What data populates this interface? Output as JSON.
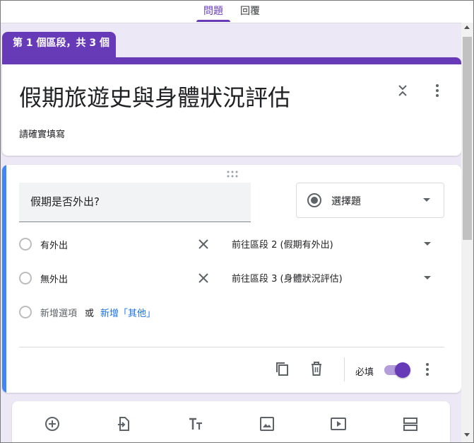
{
  "tabs": {
    "questions": "問題",
    "responses": "回覆"
  },
  "section": {
    "indicator": "第 1 個區段，共 3 個",
    "title": "假期旅遊史與身體狀況評估",
    "description": "請確實填寫"
  },
  "question": {
    "text": "假期是否外出?",
    "type": "選擇題",
    "options": [
      {
        "label": "有外出",
        "goto": "前往區段 2 (假期有外出)"
      },
      {
        "label": "無外出",
        "goto": "前往區段 3 (身體狀況評估)"
      }
    ],
    "add_option": "新增選項",
    "or": "或",
    "add_other": "新增「其他」",
    "required_label": "必填",
    "required": true
  },
  "colors": {
    "accent": "#673ab7",
    "focus_border": "#4285f4",
    "link": "#1a73e8"
  }
}
